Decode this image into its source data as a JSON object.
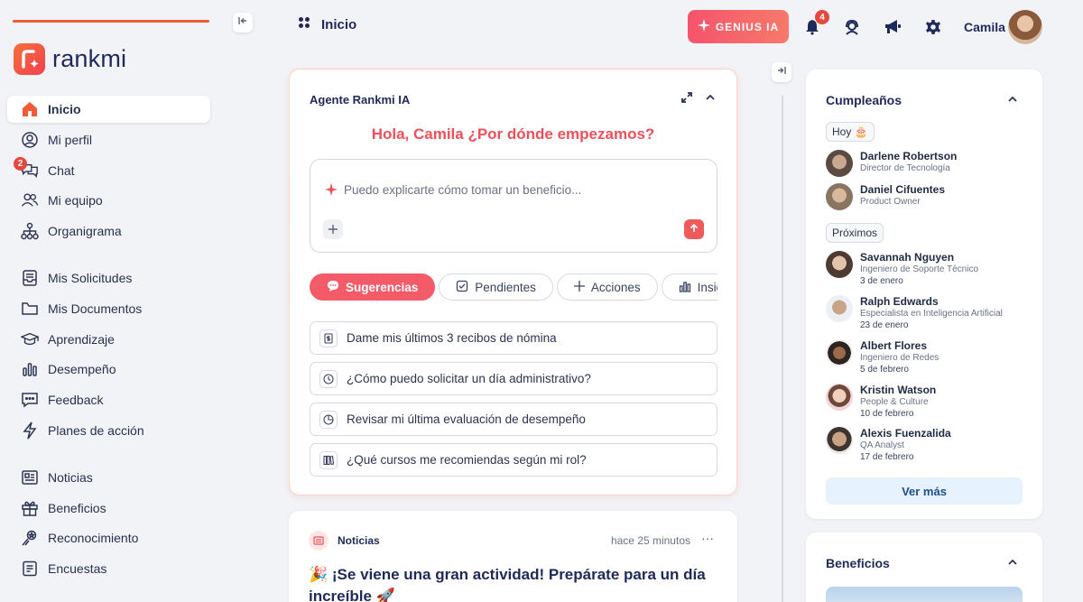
{
  "app": {
    "brand": "rankmi",
    "accent": "#f05a36",
    "genius_color": "#f5536b"
  },
  "sidebar": {
    "items": [
      {
        "label": "Inicio",
        "icon": "home-icon",
        "active": true
      },
      {
        "label": "Mi perfil",
        "icon": "user-circle-icon"
      },
      {
        "label": "Chat",
        "icon": "chat-icon",
        "badge": "2"
      },
      {
        "label": "Mi equipo",
        "icon": "team-icon"
      },
      {
        "label": "Organigrama",
        "icon": "org-chart-icon"
      },
      {
        "label": "Mis Solicitudes",
        "icon": "inbox-icon"
      },
      {
        "label": "Mis Documentos",
        "icon": "folder-icon"
      },
      {
        "label": "Aprendizaje",
        "icon": "graduation-cap-icon"
      },
      {
        "label": "Desempeño",
        "icon": "bar-chart-icon"
      },
      {
        "label": "Feedback",
        "icon": "message-dots-icon"
      },
      {
        "label": "Planes de acción",
        "icon": "bolt-icon"
      },
      {
        "label": "Noticias",
        "icon": "newspaper-icon"
      },
      {
        "label": "Beneficios",
        "icon": "gift-icon"
      },
      {
        "label": "Reconocimiento",
        "icon": "award-icon"
      },
      {
        "label": "Encuestas",
        "icon": "clipboard-icon"
      }
    ]
  },
  "header": {
    "title": "Inicio",
    "genius_label": "GENIUS IA",
    "notifications_count": "4",
    "user_name": "Camila"
  },
  "agent": {
    "title": "Agente Rankmi IA",
    "greeting": "Hola, Camila ¿Por dónde empezamos?",
    "placeholder": "Puedo explicarte cómo tomar un beneficio...",
    "tabs": [
      "Sugerencias",
      "Pendientes",
      "Acciones",
      "Insights"
    ],
    "suggestions": [
      "Dame mis últimos 3 recibos de nómina",
      "¿Cómo puedo solicitar un día administrativo?",
      "Revisar mi última evaluación de desempeño",
      "¿Qué cursos me recomiendas según mi rol?"
    ]
  },
  "news": {
    "label": "Noticias",
    "time": "hace 25 minutos",
    "more": "···",
    "title": "🎉 ¡Se viene una gran actividad! Prepárate para un día increíble 🚀"
  },
  "birthdays": {
    "title": "Cumpleaños",
    "today_label": "Hoy 🎂",
    "upcoming_label": "Próximos",
    "today": [
      {
        "name": "Darlene Robertson",
        "role": "Director de Tecnología"
      },
      {
        "name": "Daniel Cifuentes",
        "role": "Product Owner"
      }
    ],
    "upcoming": [
      {
        "name": "Savannah Nguyen",
        "role": "Ingeniero de Soporte Técnico",
        "date": "3 de enero"
      },
      {
        "name": "Ralph Edwards",
        "role": "Especialista en Inteligencia Artificial",
        "date": "23 de enero"
      },
      {
        "name": "Albert Flores",
        "role": "Ingeniero de Redes",
        "date": "5 de febrero"
      },
      {
        "name": "Kristin Watson",
        "role": "People & Culture",
        "date": "10 de febrero"
      },
      {
        "name": "Alexis Fuenzalida",
        "role": "QA Analyst",
        "date": "17 de febrero"
      }
    ],
    "see_more": "Ver más"
  },
  "benefits": {
    "title": "Beneficios"
  }
}
